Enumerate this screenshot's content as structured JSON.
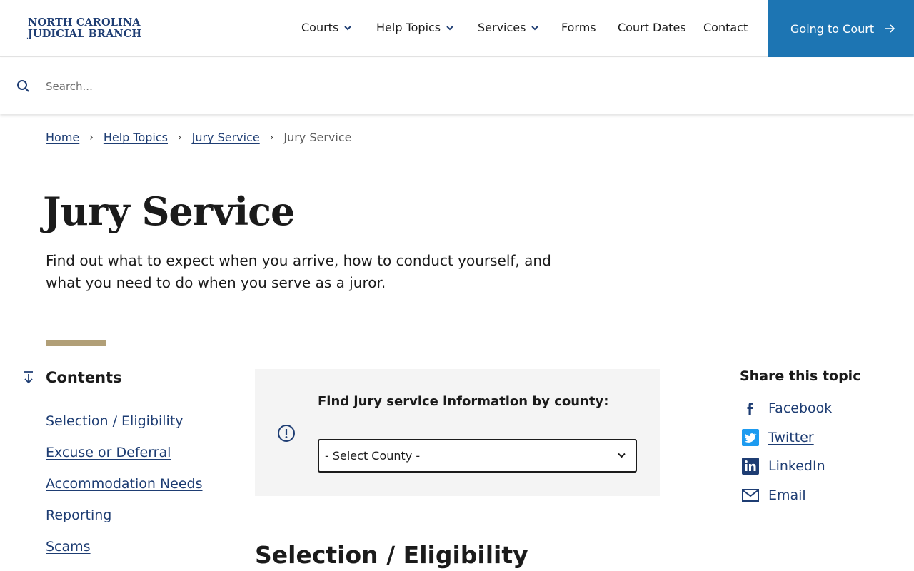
{
  "header": {
    "logo_line1": "NORTH CAROLINA",
    "logo_line2": "JUDICIAL BRANCH",
    "nav": [
      {
        "label": "Courts",
        "has_dropdown": true
      },
      {
        "label": "Help Topics",
        "has_dropdown": true
      },
      {
        "label": "Services",
        "has_dropdown": true
      },
      {
        "label": "Forms",
        "has_dropdown": false
      },
      {
        "label": "Court Dates",
        "has_dropdown": false
      },
      {
        "label": "Contact",
        "has_dropdown": false
      }
    ],
    "cta_label": "Going to Court",
    "cta_color": "#1d75b3"
  },
  "search": {
    "placeholder": "Search...",
    "value": ""
  },
  "breadcrumb": {
    "items": [
      "Home",
      "Help Topics",
      "Jury Service"
    ],
    "current": "Jury Service"
  },
  "page": {
    "title": "Jury Service",
    "lede": "Find out what to expect when you arrive, how to conduct yourself, and what you need to do when you serve as a juror."
  },
  "contents": {
    "label": "Contents",
    "items": [
      "Selection / Eligibility",
      "Excuse or Deferral",
      "Accommodation Needs",
      "Reporting",
      "Scams"
    ]
  },
  "callout": {
    "heading": "Find jury service information by county:",
    "select_value": "- Select County -"
  },
  "section": {
    "title": "Selection / Eligibility"
  },
  "share": {
    "heading": "Share this topic",
    "links": [
      {
        "label": "Facebook",
        "icon": "facebook-icon"
      },
      {
        "label": "Twitter",
        "icon": "twitter-icon"
      },
      {
        "label": "LinkedIn",
        "icon": "linkedin-icon"
      },
      {
        "label": "Email",
        "icon": "email-icon"
      }
    ]
  },
  "colors": {
    "link": "#1e3d73",
    "accent": "#b19f77",
    "callout_bg": "#f4f4f4"
  }
}
